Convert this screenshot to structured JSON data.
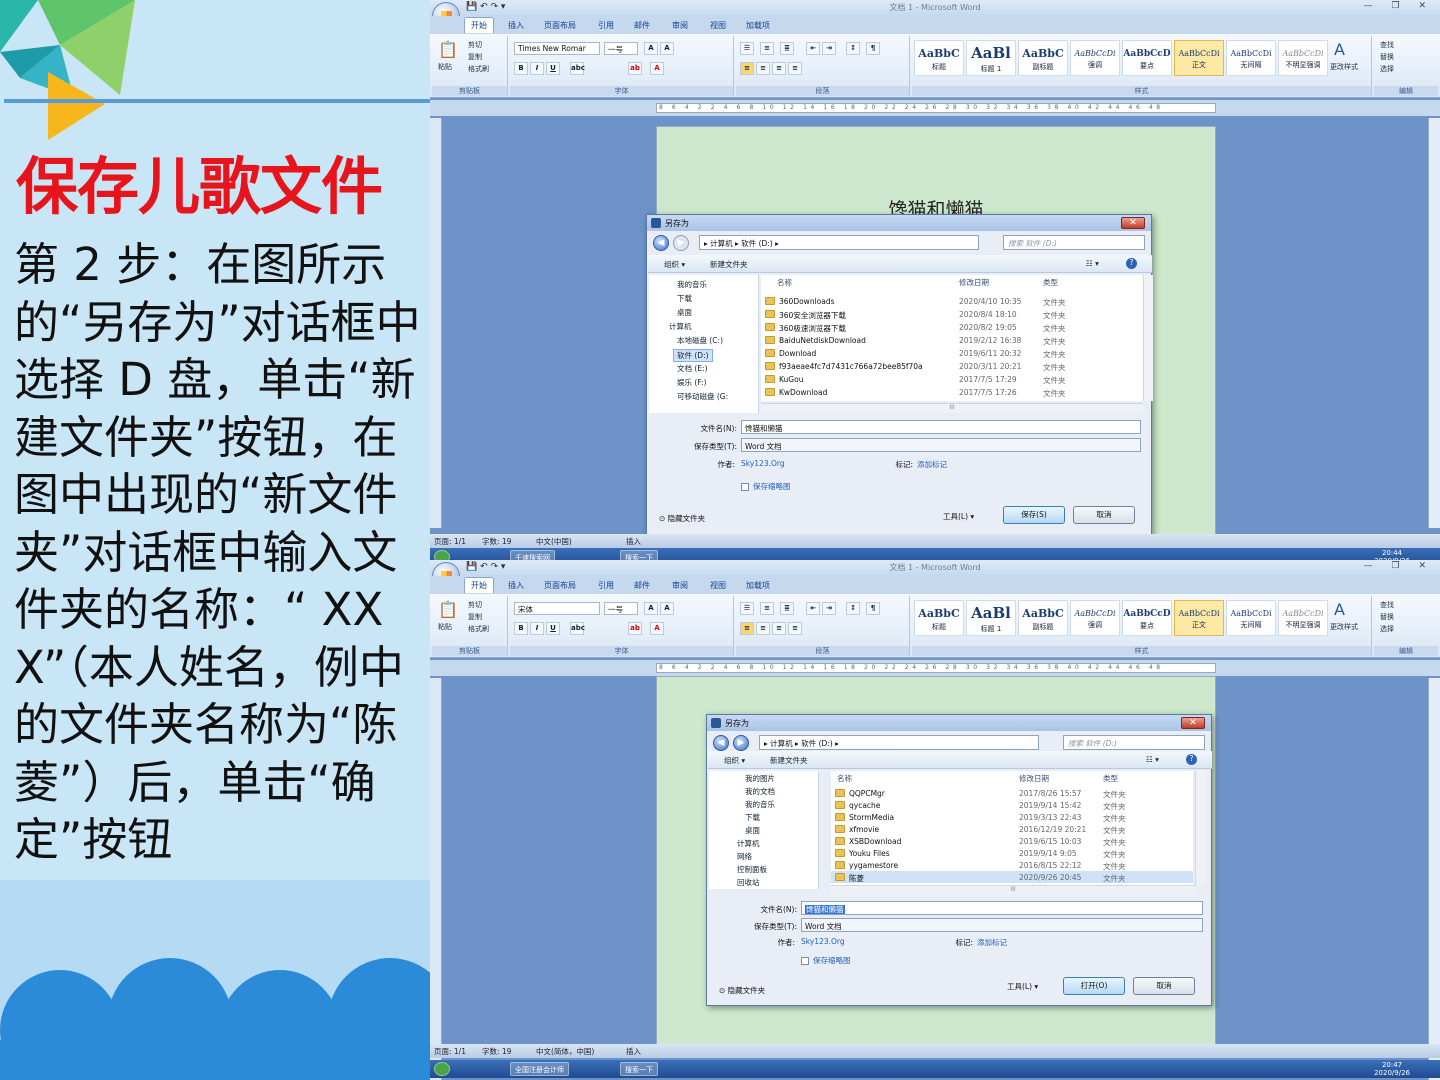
{
  "slide": {
    "title": "保存儿歌文件",
    "body": "第 2 步：在图所示的“另存为”对话框中选择 D 盘，单击“新建文件夹”按钮，在图中出现的“新文件夹”对话框中输入文件夹的名称：“ XXX”（本人姓名，例中的文件夹名称为“陈菱”）后，单击“确定”按钮"
  },
  "word": {
    "window_title": "文档 1 - Microsoft Word",
    "tabs": [
      "开始",
      "插入",
      "页面布局",
      "引用",
      "邮件",
      "审阅",
      "视图",
      "加载项"
    ],
    "groups": {
      "clipboard": "剪贴板",
      "font": "字体",
      "paragraph": "段落",
      "styles": "样式",
      "editing": "编辑"
    },
    "clipboard": {
      "paste": "粘贴",
      "cut": "剪切",
      "copy": "复制",
      "format_painter": "格式刷"
    },
    "font_name_1": "Times New Romar",
    "font_name_2": "宋体",
    "font_size": "一号",
    "styles": [
      {
        "preview": "AaBbC",
        "name": "标题"
      },
      {
        "preview": "AaBl",
        "name": "标题 1"
      },
      {
        "preview": "AaBbC",
        "name": "副标题"
      },
      {
        "preview": "AaBbCcDi",
        "name": "强调"
      },
      {
        "preview": "AaBbCcD",
        "name": "要点"
      },
      {
        "preview": "AaBbCcDi",
        "name": "正文"
      },
      {
        "preview": "AaBbCcDi",
        "name": "无间隔"
      },
      {
        "preview": "AaBbCcDi",
        "name": "不明显强调"
      }
    ],
    "change_styles": "更改样式",
    "editing": {
      "find": "查找",
      "replace": "替换",
      "select": "选择"
    },
    "ruler_ticks": "8 6 4 2 2 4 6 8 10 12 14 16 18 20 22 24 26 28 30 32 34 36 38 40 42 44 46 48",
    "doc_title": "馋猫和懒猫"
  },
  "status1": {
    "page": "页面: 1/1",
    "words": "字数: 19",
    "lang": "中文(中国)",
    "mode": "插入"
  },
  "status2": {
    "page": "页面: 1/1",
    "words": "字数: 19",
    "lang": "中文(简体，中国)",
    "mode": "插入"
  },
  "taskbar1": {
    "item1": "千速搜索网",
    "item2": "搜索一下",
    "time": "20:44",
    "date": "2020/9/26"
  },
  "taskbar2": {
    "item1": "全国注册会计师",
    "item2": "搜索一下",
    "time": "20:47",
    "date": "2020/9/26"
  },
  "dialog1": {
    "title": "另存为",
    "path": "▸ 计算机 ▸ 软件 (D:) ▸",
    "search": "搜索 软件 (D:)",
    "organize": "组织 ▾",
    "new_folder": "新建文件夹",
    "tree": [
      "我的音乐",
      "下载",
      "桌面",
      "计算机",
      "本地磁盘 (C:)",
      "软件 (D:)",
      "文档 (E:)",
      "娱乐 (F:)",
      "可移动磁盘 (G:"
    ],
    "columns": [
      "名称",
      "修改日期",
      "类型"
    ],
    "rows": [
      {
        "name": "360Downloads",
        "date": "2020/4/10 10:35",
        "type": "文件夹"
      },
      {
        "name": "360安全浏览器下载",
        "date": "2020/8/4 18:10",
        "type": "文件夹"
      },
      {
        "name": "360极速浏览器下载",
        "date": "2020/8/2 19:05",
        "type": "文件夹"
      },
      {
        "name": "BaiduNetdiskDownload",
        "date": "2019/2/12 16:38",
        "type": "文件夹"
      },
      {
        "name": "Download",
        "date": "2019/6/11 20:32",
        "type": "文件夹"
      },
      {
        "name": "f93aeae4fc7d7431c766a72bee85f70a",
        "date": "2020/3/11 20:21",
        "type": "文件夹"
      },
      {
        "name": "KuGou",
        "date": "2017/7/5 17:29",
        "type": "文件夹"
      },
      {
        "name": "KwDownload",
        "date": "2017/7/5 17:26",
        "type": "文件夹"
      }
    ],
    "filename_label": "文件名(N):",
    "filename": "馋猫和懒猫",
    "filetype_label": "保存类型(T):",
    "filetype": "Word 文档",
    "author_label": "作者:",
    "author": "Sky123.Org",
    "tags_label": "标记:",
    "tags": "添加标记",
    "thumb": "保存缩略图",
    "hide": "隐藏文件夹",
    "tools": "工具(L)",
    "save": "保存(S)",
    "cancel": "取消"
  },
  "dialog2": {
    "title": "另存为",
    "path": "▸ 计算机 ▸ 软件 (D:) ▸",
    "search": "搜索 软件 (D:)",
    "organize": "组织 ▾",
    "new_folder": "新建文件夹",
    "tree": [
      "我的图片",
      "我的文档",
      "我的音乐",
      "下载",
      "桌面",
      "计算机",
      "网络",
      "控制面板",
      "回收站"
    ],
    "columns": [
      "名称",
      "修改日期",
      "类型"
    ],
    "rows": [
      {
        "name": "QQPCMgr",
        "date": "2017/8/26 15:57",
        "type": "文件夹"
      },
      {
        "name": "qycache",
        "date": "2019/9/14 15:42",
        "type": "文件夹"
      },
      {
        "name": "StormMedia",
        "date": "2019/3/13 22:43",
        "type": "文件夹"
      },
      {
        "name": "xfmovie",
        "date": "2016/12/19 20:21",
        "type": "文件夹"
      },
      {
        "name": "XSBDownload",
        "date": "2019/6/15 10:03",
        "type": "文件夹"
      },
      {
        "name": "Youku Files",
        "date": "2019/9/14 9:05",
        "type": "文件夹"
      },
      {
        "name": "yygamestore",
        "date": "2016/8/15 22:12",
        "type": "文件夹"
      },
      {
        "name": "陈菱",
        "date": "2020/9/26 20:45",
        "type": "文件夹"
      }
    ],
    "filename_label": "文件名(N):",
    "filename": "馋猫和懒猫",
    "filetype_label": "保存类型(T):",
    "filetype": "Word 文档",
    "author_label": "作者:",
    "author": "Sky123.Org",
    "tags_label": "标记:",
    "tags": "添加标记",
    "thumb": "保存缩略图",
    "hide": "隐藏文件夹",
    "tools": "工具(L)",
    "save": "打开(O)",
    "cancel": "取消"
  }
}
